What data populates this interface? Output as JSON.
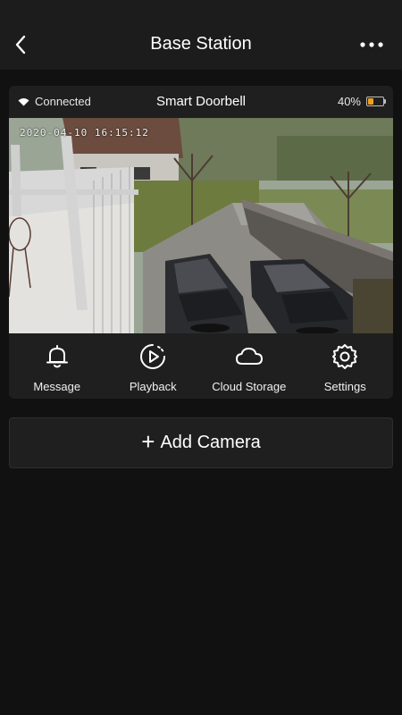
{
  "header": {
    "title": "Base Station",
    "back_icon": "chevron-left-icon",
    "more_icon": "more-dots-icon"
  },
  "camera_card": {
    "connection_status": "Connected",
    "camera_name": "Smart Doorbell",
    "battery_text": "40%",
    "battery_level": 0.4,
    "battery_color": "#f0a020",
    "timestamp": "2020-04-10 16:15:12"
  },
  "actions": [
    {
      "label": "Message",
      "icon": "bell-icon"
    },
    {
      "label": "Playback",
      "icon": "playback-icon"
    },
    {
      "label": "Cloud Storage",
      "icon": "cloud-icon"
    },
    {
      "label": "Settings",
      "icon": "gear-icon"
    }
  ],
  "add_camera": {
    "label": "Add Camera",
    "icon": "plus-icon"
  },
  "colors": {
    "background": "#111111",
    "header": "#1c1c1c",
    "card": "#1f1f1f"
  }
}
